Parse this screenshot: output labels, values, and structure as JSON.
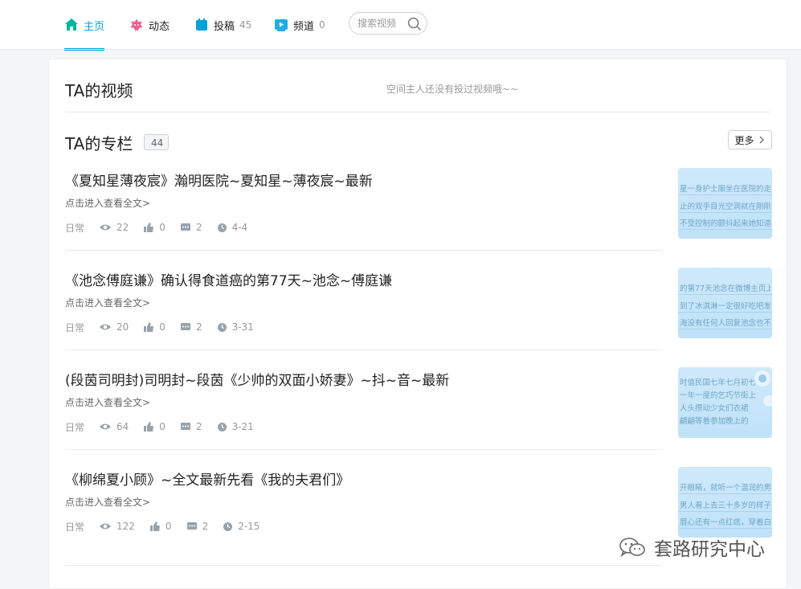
{
  "nav": {
    "home": "主页",
    "dynamic": "动态",
    "posts": "投稿",
    "posts_count": "45",
    "channels": "频道",
    "channels_count": "0",
    "search_placeholder": "搜索视频"
  },
  "videos": {
    "title": "TA的视频",
    "empty_message": "空间主人还没有投过视频哦~~"
  },
  "columns": {
    "title": "TA的专栏",
    "count": "44",
    "more": "更多",
    "read_more": "点击进入查看全文>",
    "items": [
      {
        "title": "《夏知星薄夜宸》瀚明医院~夏知星~薄夜宸~最新",
        "category": "日常",
        "views": "22",
        "likes": "0",
        "comments": "2",
        "date": "4-4",
        "thumb_lines": [
          "星一身护士服坐在医院的走",
          "止的双手目光空洞就在刚刚",
          "不受控制的颤抖起来她知道"
        ]
      },
      {
        "title": "《池念傅庭谦》确认得食道癌的第77天~池念~傅庭谦",
        "category": "日常",
        "views": "20",
        "likes": "0",
        "comments": "2",
        "date": "3-31",
        "thumb_lines": [
          "的第77天池念在微博主页上",
          "到了冰淇淋一定很好吃吧发",
          "海没有任何人回复池念也不"
        ]
      },
      {
        "title": "(段茵司明封)司明封~段茵《少帅的双面小娇妻》~抖~音~最新",
        "category": "日常",
        "views": "64",
        "likes": "0",
        "comments": "2",
        "date": "3-21",
        "thumb_lines": [
          "时值民国七年七月初七",
          "一年一度的乞巧节街上",
          "人头攒动少女们衣裙",
          "翩翩等着参加晚上的"
        ]
      },
      {
        "title": "《柳绵夏小顾》~全文最新先看《我的夫君们》",
        "category": "日常",
        "views": "122",
        "likes": "0",
        "comments": "2",
        "date": "2-15",
        "thumb_lines": [
          "开眼睛，就听一个温润的男",
          "男人看上去三十多岁的样子",
          "眉心还有一点红痣，穿着白"
        ]
      }
    ]
  },
  "watermark": "套路研究中心",
  "colors": {
    "accent": "#00a1d6",
    "home_icon": "#00b5a0",
    "dynamic_icon": "#f25d8e",
    "post_icon": "#00a1d6",
    "channel_icon": "#23ade5"
  }
}
